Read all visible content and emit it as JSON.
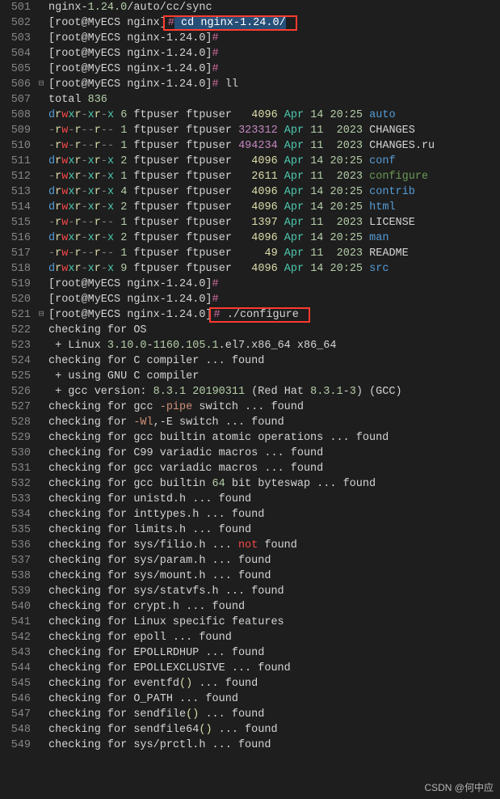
{
  "watermark": "CSDN @何中应",
  "first_line_no": 501,
  "highlights": {
    "box1_line": 502,
    "box2_line": 521
  },
  "lines": [
    {
      "t": "path",
      "tokens": [
        [
          "nginx",
          "c-def"
        ],
        [
          "-",
          "c-def"
        ],
        [
          "1.24.0",
          "c-num"
        ],
        [
          "/auto/cc/sync",
          "c-def"
        ]
      ]
    },
    {
      "t": "prompt",
      "boxed": 1,
      "prompt": "[root@MyECS nginx]",
      "cmd_tokens": [
        [
          " cd ",
          "sel"
        ],
        [
          "nginx",
          "sel"
        ],
        [
          "-",
          "sel"
        ],
        [
          "1.24.0",
          "sel"
        ],
        [
          "/",
          "sel"
        ]
      ]
    },
    {
      "t": "prompt",
      "prompt": "[root@MyECS nginx-1.24.0]",
      "cmd_tokens": []
    },
    {
      "t": "prompt",
      "prompt": "[root@MyECS nginx-1.24.0]",
      "cmd_tokens": []
    },
    {
      "t": "prompt",
      "prompt": "[root@MyECS nginx-1.24.0]",
      "cmd_tokens": []
    },
    {
      "t": "prompt",
      "fold": "⊟",
      "prompt": "[root@MyECS nginx-1.24.0]",
      "cmd_tokens": [
        [
          " ll",
          "c-def"
        ]
      ]
    },
    {
      "t": "plain",
      "tokens": [
        [
          "total ",
          "c-def"
        ],
        [
          "836",
          "c-num"
        ]
      ]
    },
    {
      "t": "ls",
      "perm": "drwxr-xr-x",
      "n": "6",
      "size": "4096",
      "month": "Apr",
      "day": "14",
      "time": "20:25",
      "name": "auto",
      "cls": "fdir"
    },
    {
      "t": "ls",
      "perm": "-rw-r--r--",
      "n": "1",
      "size": "323312",
      "sizecls": "size-p",
      "month": "Apr",
      "day": "11",
      "time": " 2023",
      "name": "CHANGES",
      "cls": "fname"
    },
    {
      "t": "ls",
      "perm": "-rw-r--r--",
      "n": "1",
      "size": "494234",
      "sizecls": "size-p",
      "month": "Apr",
      "day": "11",
      "time": " 2023",
      "name": "CHANGES.ru",
      "cls": "fname"
    },
    {
      "t": "ls",
      "perm": "drwxr-xr-x",
      "n": "2",
      "size": "4096",
      "month": "Apr",
      "day": "14",
      "time": "20:25",
      "name": "conf",
      "cls": "fdir"
    },
    {
      "t": "ls",
      "perm": "-rwxr-xr-x",
      "n": "1",
      "size": "2611",
      "month": "Apr",
      "day": "11",
      "time": " 2023",
      "name": "configure",
      "cls": "fexec"
    },
    {
      "t": "ls",
      "perm": "drwxr-xr-x",
      "n": "4",
      "size": "4096",
      "month": "Apr",
      "day": "14",
      "time": "20:25",
      "name": "contrib",
      "cls": "fdir"
    },
    {
      "t": "ls",
      "perm": "drwxr-xr-x",
      "n": "2",
      "size": "4096",
      "month": "Apr",
      "day": "14",
      "time": "20:25",
      "name": "html",
      "cls": "fdir"
    },
    {
      "t": "ls",
      "perm": "-rw-r--r--",
      "n": "1",
      "size": "1397",
      "month": "Apr",
      "day": "11",
      "time": " 2023",
      "name": "LICENSE",
      "cls": "fname"
    },
    {
      "t": "ls",
      "perm": "drwxr-xr-x",
      "n": "2",
      "size": "4096",
      "month": "Apr",
      "day": "14",
      "time": "20:25",
      "name": "man",
      "cls": "fdir"
    },
    {
      "t": "ls",
      "perm": "-rw-r--r--",
      "n": "1",
      "size": "49",
      "month": "Apr",
      "day": "11",
      "time": " 2023",
      "name": "README",
      "cls": "fname"
    },
    {
      "t": "ls",
      "perm": "drwxr-xr-x",
      "n": "9",
      "size": "4096",
      "month": "Apr",
      "day": "14",
      "time": "20:25",
      "name": "src",
      "cls": "fdir"
    },
    {
      "t": "prompt",
      "prompt": "[root@MyECS nginx-1.24.0]",
      "cmd_tokens": []
    },
    {
      "t": "prompt",
      "prompt": "[root@MyECS nginx-1.24.0]",
      "cmd_tokens": []
    },
    {
      "t": "prompt",
      "fold": "⊟",
      "boxed": 2,
      "prompt": "[root@MyECS nginx-1.24.0]",
      "cmd_tokens": [
        [
          " ./configure",
          "c-def"
        ]
      ]
    },
    {
      "t": "plain",
      "tokens": [
        [
          "checking for OS",
          "c-def"
        ]
      ]
    },
    {
      "t": "plain",
      "tokens": [
        [
          " + Linux ",
          "c-def"
        ],
        [
          "3.10.0",
          "c-num"
        ],
        [
          "-",
          "c-def"
        ],
        [
          "1160.105.1",
          "c-num"
        ],
        [
          ".el7.x86_64 x86_64",
          "c-def"
        ]
      ]
    },
    {
      "t": "plain",
      "tokens": [
        [
          "checking for C compiler ... found",
          "c-def"
        ]
      ]
    },
    {
      "t": "plain",
      "tokens": [
        [
          " + using GNU C compiler",
          "c-def"
        ]
      ]
    },
    {
      "t": "plain",
      "tokens": [
        [
          " + gcc version",
          "c-def"
        ],
        [
          ":",
          "c-def"
        ],
        [
          " ",
          "c-def"
        ],
        [
          "8.3.1",
          "c-num"
        ],
        [
          " ",
          "c-def"
        ],
        [
          "20190311",
          "c-num"
        ],
        [
          " ",
          "c-def"
        ],
        [
          "(",
          "c-def"
        ],
        [
          "Red Hat ",
          "c-def"
        ],
        [
          "8.3.1",
          "c-num"
        ],
        [
          "-",
          "c-def"
        ],
        [
          "3",
          "c-num"
        ],
        [
          ")",
          "c-def"
        ],
        [
          " ",
          "c-def"
        ],
        [
          "(",
          "c-def"
        ],
        [
          "GCC",
          "c-def"
        ],
        [
          ")",
          "c-def"
        ]
      ]
    },
    {
      "t": "plain",
      "tokens": [
        [
          "checking for gcc ",
          "c-def"
        ],
        [
          "-pipe",
          "c-orange"
        ],
        [
          " switch ... found",
          "c-def"
        ]
      ]
    },
    {
      "t": "plain",
      "tokens": [
        [
          "checking for ",
          "c-def"
        ],
        [
          "-Wl",
          "c-orange"
        ],
        [
          ",",
          "c-def"
        ],
        [
          "-E switch ... found",
          "c-def"
        ]
      ]
    },
    {
      "t": "plain",
      "tokens": [
        [
          "checking for gcc builtin atomic operations ... found",
          "c-def"
        ]
      ]
    },
    {
      "t": "plain",
      "tokens": [
        [
          "checking for C99 variadic macros ... found",
          "c-def"
        ]
      ]
    },
    {
      "t": "plain",
      "tokens": [
        [
          "checking for gcc variadic macros ... found",
          "c-def"
        ]
      ]
    },
    {
      "t": "plain",
      "tokens": [
        [
          "checking for gcc builtin ",
          "c-def"
        ],
        [
          "64",
          "c-num"
        ],
        [
          " bit byteswap ... found",
          "c-def"
        ]
      ]
    },
    {
      "t": "plain",
      "tokens": [
        [
          "checking for unistd.h ... found",
          "c-def"
        ]
      ]
    },
    {
      "t": "plain",
      "tokens": [
        [
          "checking for inttypes.h ... found",
          "c-def"
        ]
      ]
    },
    {
      "t": "plain",
      "tokens": [
        [
          "checking for limits.h ... found",
          "c-def"
        ]
      ]
    },
    {
      "t": "plain",
      "tokens": [
        [
          "checking for sys/filio.h ... ",
          "c-def"
        ],
        [
          "not",
          "c-red"
        ],
        [
          " found",
          "c-def"
        ]
      ]
    },
    {
      "t": "plain",
      "tokens": [
        [
          "checking for sys/param.h ... found",
          "c-def"
        ]
      ]
    },
    {
      "t": "plain",
      "tokens": [
        [
          "checking for sys/mount.h ... found",
          "c-def"
        ]
      ]
    },
    {
      "t": "plain",
      "tokens": [
        [
          "checking for sys/statvfs.h ... found",
          "c-def"
        ]
      ]
    },
    {
      "t": "plain",
      "tokens": [
        [
          "checking for crypt.h ... found",
          "c-def"
        ]
      ]
    },
    {
      "t": "plain",
      "tokens": [
        [
          "checking for Linux specific features",
          "c-def"
        ]
      ]
    },
    {
      "t": "plain",
      "tokens": [
        [
          "checking for epoll ... found",
          "c-def"
        ]
      ]
    },
    {
      "t": "plain",
      "tokens": [
        [
          "checking for EPOLLRDHUP ... found",
          "c-def"
        ]
      ]
    },
    {
      "t": "plain",
      "tokens": [
        [
          "checking for EPOLLEXCLUSIVE ... found",
          "c-def"
        ]
      ]
    },
    {
      "t": "plain",
      "tokens": [
        [
          "checking for eventfd",
          "c-def"
        ],
        [
          "()",
          "c-yellow"
        ],
        [
          " ... found",
          "c-def"
        ]
      ]
    },
    {
      "t": "plain",
      "tokens": [
        [
          "checking for O_PATH ... found",
          "c-def"
        ]
      ]
    },
    {
      "t": "plain",
      "tokens": [
        [
          "checking for sendfile",
          "c-def"
        ],
        [
          "()",
          "c-yellow"
        ],
        [
          " ... found",
          "c-def"
        ]
      ]
    },
    {
      "t": "plain",
      "tokens": [
        [
          "checking for sendfile64",
          "c-def"
        ],
        [
          "()",
          "c-yellow"
        ],
        [
          " ... found",
          "c-def"
        ]
      ]
    },
    {
      "t": "plain",
      "tokens": [
        [
          "checking for sys/prctl.h ... found",
          "c-def"
        ]
      ]
    }
  ]
}
